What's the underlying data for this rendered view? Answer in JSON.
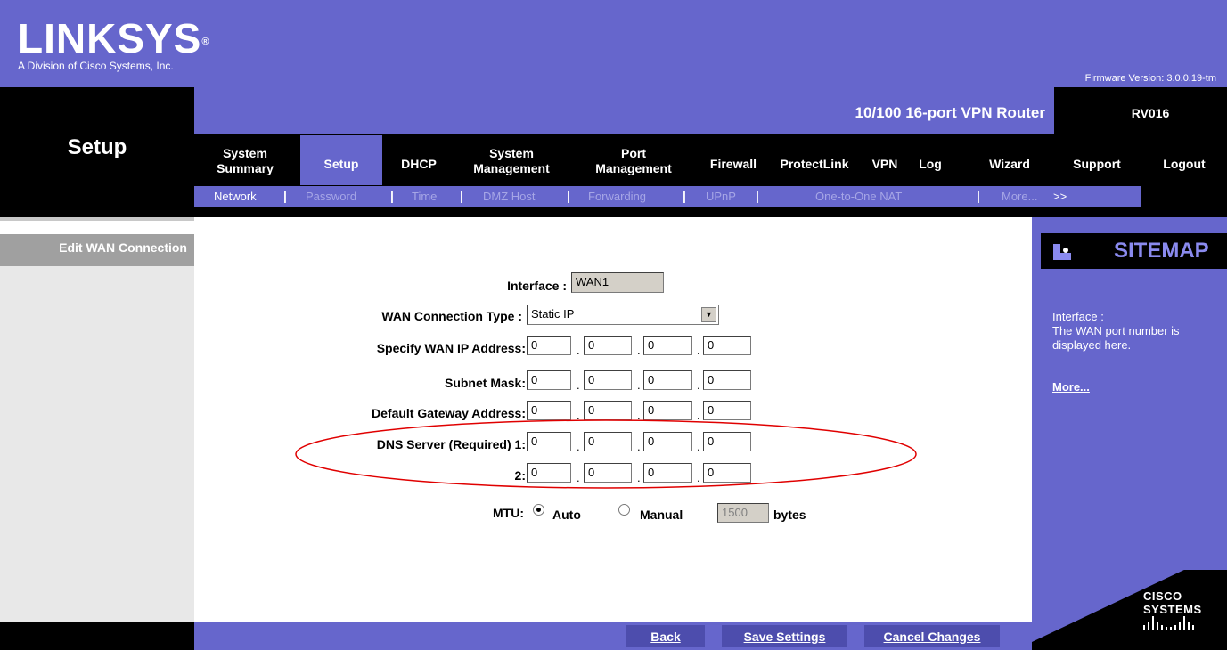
{
  "header": {
    "logo": "LINKSYS",
    "logo_mark": "®",
    "tagline": "A Division of Cisco Systems, Inc.",
    "firmware": "Firmware Version: 3.0.0.19-tm",
    "product_name": "10/100 16-port VPN Router",
    "model": "RV016",
    "section_title": "Setup"
  },
  "tabs": [
    {
      "line1": "System",
      "line2": "Summary"
    },
    {
      "line1": "Setup",
      "line2": ""
    },
    {
      "line1": "DHCP",
      "line2": ""
    },
    {
      "line1": "System",
      "line2": "Management"
    },
    {
      "line1": "Port",
      "line2": "Management"
    },
    {
      "line1": "Firewall",
      "line2": ""
    },
    {
      "line1": "ProtectLink",
      "line2": ""
    },
    {
      "line1": "VPN",
      "line2": ""
    },
    {
      "line1": "Log",
      "line2": ""
    },
    {
      "line1": "Wizard",
      "line2": ""
    },
    {
      "line1": "Support",
      "line2": ""
    },
    {
      "line1": "Logout",
      "line2": ""
    }
  ],
  "subnav": [
    "Network",
    "Password",
    "Time",
    "DMZ Host",
    "Forwarding",
    "UPnP",
    "One-to-One NAT",
    "More...",
    ">>"
  ],
  "sidebar": {
    "label": "Edit WAN Connection"
  },
  "form": {
    "interface_label": "Interface :",
    "interface_value": "WAN1",
    "conn_type_label": "WAN Connection Type :",
    "conn_type_value": "Static IP",
    "wan_ip_label": "Specify WAN IP Address:",
    "wan_ip": [
      "0",
      "0",
      "0",
      "0"
    ],
    "subnet_label": "Subnet Mask:",
    "subnet": [
      "0",
      "0",
      "0",
      "0"
    ],
    "gateway_label": "Default Gateway Address:",
    "gateway": [
      "0",
      "0",
      "0",
      "0"
    ],
    "dns1_label": "DNS Server (Required) 1:",
    "dns1": [
      "0",
      "0",
      "0",
      "0"
    ],
    "dns2_label": "2:",
    "dns2": [
      "0",
      "0",
      "0",
      "0"
    ],
    "mtu_label": "MTU:",
    "mtu_auto": "Auto",
    "mtu_manual": "Manual",
    "mtu_value": "1500",
    "mtu_unit": "bytes",
    "mtu_selected": "Auto"
  },
  "sitemap": {
    "title": "SITEMAP",
    "help_line1": "Interface :",
    "help_line2": "The WAN port number is displayed here.",
    "more": "More..."
  },
  "footer": {
    "back": "Back",
    "save": "Save Settings",
    "cancel": "Cancel Changes"
  },
  "brand": {
    "cisco": "CISCO SYSTEMS"
  },
  "colors": {
    "brand_purple": "#6666cc",
    "black": "#000000",
    "annotation_red": "#e00000"
  }
}
